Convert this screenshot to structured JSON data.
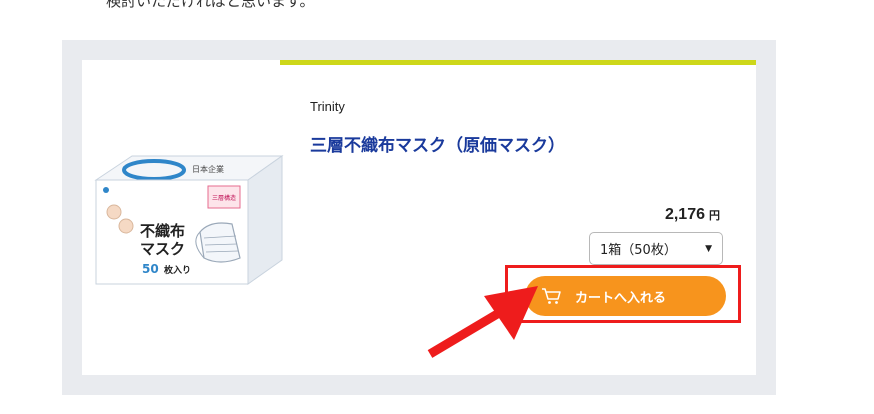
{
  "page": {
    "intro_text": "検討いただければと思います。"
  },
  "product": {
    "brand": "Trinity",
    "title": "三層不織布マスク（原価マスク）",
    "price": "2,176",
    "price_unit": "円",
    "quantity_selected": "1箱（50枚）",
    "cart_button_label": "カートへ入れる",
    "image": {
      "box_text_line1": "不織布",
      "box_text_line2": "マスク",
      "box_count_number": "50",
      "box_count_label": "枚入り",
      "box_badge": "三層構造",
      "box_accent_color": "#2f86c9"
    }
  },
  "colors": {
    "panel_bg": "#e9ebef",
    "accent_bar": "#cdd71a",
    "title": "#1a3a9c",
    "cart_button": "#f7941d",
    "annotation_red": "#ee1c1c"
  }
}
